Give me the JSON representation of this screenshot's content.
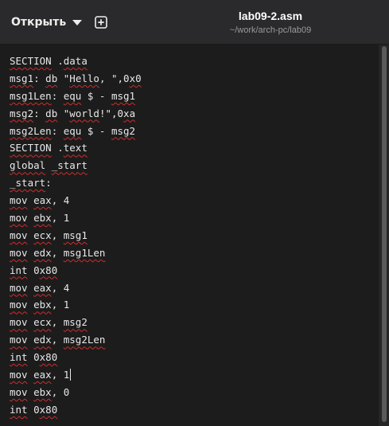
{
  "header": {
    "open_label": "Открыть",
    "title": "lab09-2.asm",
    "subtitle": "~/work/arch-pc/lab09"
  },
  "editor": {
    "lines": [
      "SECTION .data",
      "msg1: db \"Hello, \",0x0",
      "msg1Len: equ $ - msg1",
      "msg2: db \"world!\",0xa",
      "msg2Len: equ $ - msg2",
      "SECTION .text",
      "global _start",
      "_start:",
      "mov eax, 4",
      "mov ebx, 1",
      "mov ecx, msg1",
      "mov edx, msg1Len",
      "int 0x80",
      "mov eax, 4",
      "mov ebx, 1",
      "mov ecx, msg2",
      "mov edx, msg2Len",
      "int 0x80",
      "mov eax, 1",
      "mov ebx, 0",
      "int 0x80"
    ],
    "cursor_line": 18
  },
  "colors": {
    "background": "#1c1c1c",
    "headerbar": "#2a2a2c",
    "text": "#e8e8e8",
    "spellcheck_underline": "#d02c2c"
  }
}
